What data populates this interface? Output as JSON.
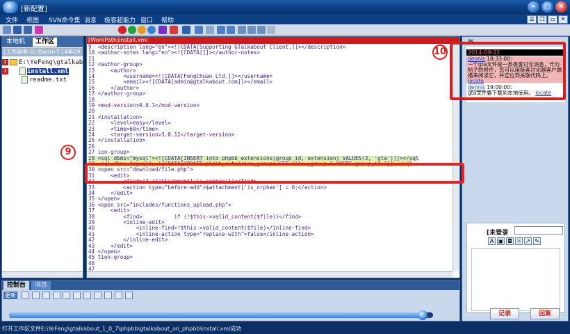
{
  "title": "[新配置]",
  "window_controls": [
    "–",
    "□",
    "✕"
  ],
  "menu": [
    "文件",
    "视图",
    "SVN命令集",
    "消息",
    "极客超能力",
    "窗口",
    "帮助"
  ],
  "mdi_controls": [
    "☰",
    "❐",
    "▭",
    "✕"
  ],
  "left": {
    "tabs": [
      "本地机",
      "工作区"
    ],
    "workspace_path": "[工作副本:6] 由adm于14年09...",
    "tree": [
      {
        "badge": "2",
        "label": "E:\\YeFeng\\gtalkab"
      },
      {
        "badge": "2",
        "label": "install.xml"
      },
      {
        "badge": "",
        "label": "readme.txt"
      }
    ]
  },
  "editor": {
    "title": "[WorkPath]install.xml",
    "lines": [
      "9  <description lang=\"en\"><![CDATA[Supporting GTalkabout Client.]]></description>",
      "10 <author-notes lang=\"en\"><![CDATA[]]></author-notes>",
      "11",
      "12 <author-group>",
      "13     <author>",
      "14         <username><![CDATA[FengChuan Ltd.]]></username>",
      "15         <email><![CDATA[admin@gtalkabout.com]]></email>",
      "16     </author>",
      "17 </author-group>",
      "18",
      "19 <mod-version>0.0.1</mod-version>",
      "20",
      "21 <installation>",
      "22     <level>easy</level>",
      "23     <time>60</time>",
      "24     <target-version>3.0.12</target-version>",
      "25 </installation>",
      "26",
      "27 ion-group>",
      "28 <sql dbms=\"mysql\"><![CDATA[INSERT into phpbb_extensions(group_id, extension) VALUES(3, 'gta')]]></sql",
      "29 <sql dbms=\"mysql\"><![CDATA[UPDATE phpbb_extension_groups SET allow_group=1 WHERE group_id=3]]></sql",
      "30 <open src=\"download/file.php\">",
      "31     <edit>",
      "32         <find>if ($attachment['is_orphan'])</find>",
      "33         <action type=\"before-add\">$attachment['is_orphan'] = 0;</action>",
      "34     </edit>",
      "35 </open>",
      "36 <open src=\"includes/functions_upload.php\">",
      "37     <edit>",
      "38         <find>          if (!$this->valid_content($file))</find>",
      "39         <inline-edit>",
      "40             <inline-find>!$this->valid_content($file)</inline-find>",
      "41             <inline-action type=\"replace-with\">false</inline-action>",
      "42         </inline-edit>",
      "43     </edit>",
      "44 </open>",
      "45 tion-group>",
      "46",
      "47"
    ]
  },
  "chat": {
    "header": "群",
    "date": "2014-09-22",
    "messages": [
      {
        "name": "dennis",
        "time": "18:33:00：",
        "text": "一个gta文件是一条极客讨论消息，作为帖子的附件，您可以用极客讨论器客户端播来阅读它，并定位到关联代码上。",
        "link": "locate"
      },
      {
        "name": "dennis",
        "time": "19:00:00：",
        "text": "gta文件要下载到本地使用。",
        "link": "locate"
      }
    ],
    "login_label": "[未登录",
    "format_icons": [
      "A",
      "▣",
      "◘",
      "☼",
      "↗",
      "✎"
    ],
    "record_button": "记录",
    "reply_button": "回复"
  },
  "console": {
    "tabs": [
      "控制台",
      "消息"
    ],
    "toolbar": [
      "更新",
      "✱",
      "✱",
      "✱",
      "✱",
      "✱",
      "✱",
      "◉",
      "◉",
      "⚑",
      "⚑",
      "▣"
    ],
    "progress": 0.98
  },
  "status": "打开工作区文件E:\\YeFeng\\gtalkabout_1_0_7\\phpbb\\gtalkabout_on_phpbb\\install.xml成功",
  "annotations": {
    "a": "9",
    "b": "10"
  }
}
